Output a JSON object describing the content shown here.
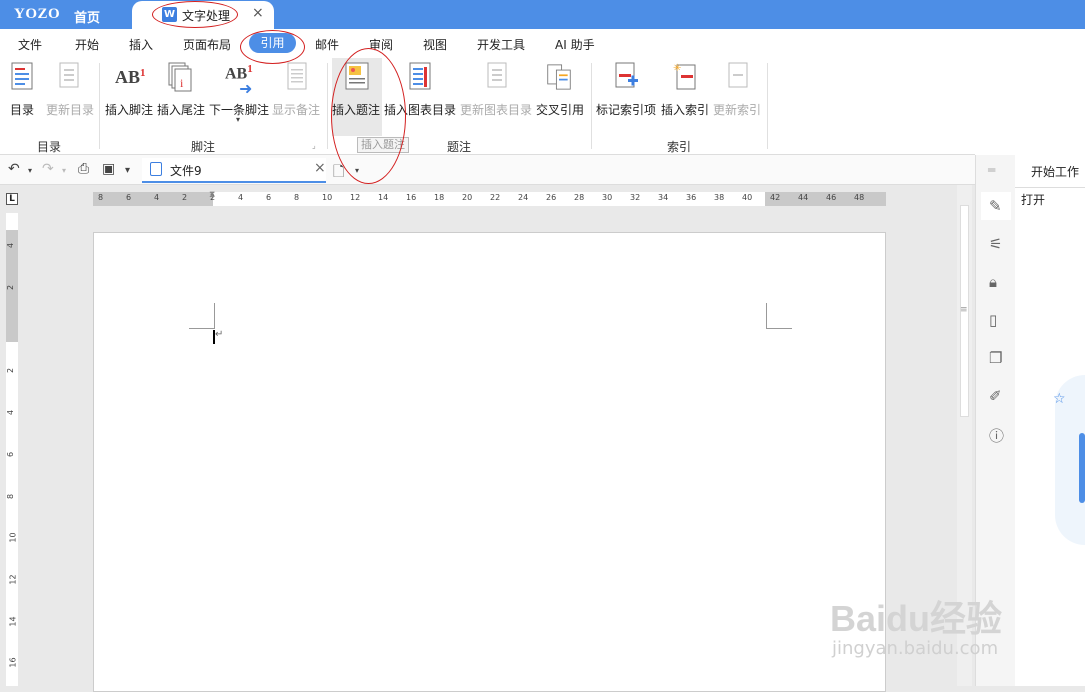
{
  "titlebar": {
    "brand": "YOZO",
    "home": "首页",
    "doc_tab_icon": "W",
    "doc_tab": "文字处理",
    "close": "×"
  },
  "menu": [
    "文件",
    "开始",
    "插入",
    "页面布局",
    "引用",
    "邮件",
    "审阅",
    "视图",
    "开发工具",
    "AI 助手"
  ],
  "active_menu": "引用",
  "ribbon": {
    "buttons": [
      "目录",
      "更新目录",
      "插入脚注",
      "插入尾注",
      "下一条脚注",
      "显示备注",
      "插入题注",
      "插入图表目录",
      "更新图表目录",
      "交叉引用",
      "标记索引项",
      "插入索引",
      "更新索引"
    ],
    "groups": [
      "目录",
      "脚注",
      "题注",
      "索引"
    ],
    "tooltip": "插入题注",
    "ab_text": "AB",
    "ab_sup": "1"
  },
  "toolbar": {
    "file_tab": "文件9",
    "close": "×"
  },
  "ruler": {
    "ticks": [
      "8",
      "6",
      "4",
      "2",
      "2",
      "4",
      "6",
      "8",
      "10",
      "12",
      "14",
      "16",
      "18",
      "20",
      "22",
      "24",
      "26",
      "28",
      "30",
      "32",
      "34",
      "36",
      "38",
      "40",
      "42",
      "44",
      "46",
      "48"
    ],
    "vticks": [
      "4",
      "2",
      "2",
      "4",
      "6",
      "8",
      "10",
      "12",
      "14",
      "16"
    ],
    "corner": "L"
  },
  "side_panel": {
    "title": "开始工作",
    "open": "打开"
  },
  "watermark": {
    "text": "Baidu经验",
    "url": "jingyan.baidu.com"
  },
  "colors": {
    "accent": "#4d8ee6",
    "annotation": "#d32020"
  }
}
